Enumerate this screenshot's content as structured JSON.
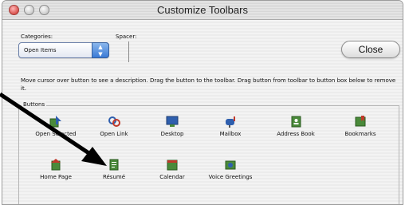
{
  "window": {
    "title": "Customize Toolbars"
  },
  "categories": {
    "label": "Categories:",
    "selected": "Open Items"
  },
  "spacer": {
    "label": "Spacer:"
  },
  "close_label": "Close",
  "description": "Move cursor over button to see a description. Drag the button to the toolbar. Drag button from toolbar to button box below to remove it.",
  "buttons_group": {
    "title": "Buttons",
    "items": [
      {
        "label": "Open Selected",
        "icon": "open-selected-icon"
      },
      {
        "label": "Open Link",
        "icon": "open-link-icon"
      },
      {
        "label": "Desktop",
        "icon": "desktop-icon"
      },
      {
        "label": "Mailbox",
        "icon": "mailbox-icon"
      },
      {
        "label": "Address Book",
        "icon": "address-book-icon"
      },
      {
        "label": "Bookmarks",
        "icon": "bookmarks-icon"
      },
      {
        "label": "Home Page",
        "icon": "home-page-icon"
      },
      {
        "label": "Résumé",
        "icon": "resume-icon"
      },
      {
        "label": "Calendar",
        "icon": "calendar-icon"
      },
      {
        "label": "Voice Greetings",
        "icon": "voice-greetings-icon"
      }
    ]
  },
  "colors": {
    "icon_green": "#4a8a3a",
    "icon_blue": "#2f5fae",
    "icon_red": "#c0392b",
    "popup_accent": "#3a7ad6"
  }
}
